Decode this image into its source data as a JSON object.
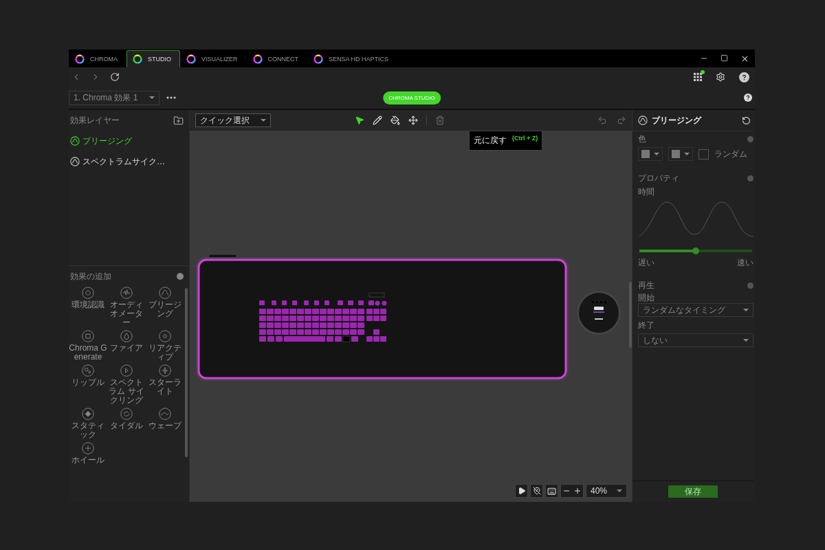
{
  "tabs": [
    {
      "label": "CHROMA",
      "selected": false
    },
    {
      "label": "STUDIO",
      "selected": true
    },
    {
      "label": "VISUALIZER",
      "selected": false
    },
    {
      "label": "CONNECT",
      "selected": false
    },
    {
      "label": "SENSA HD HAPTICS",
      "selected": false
    }
  ],
  "apps": {
    "notification": true
  },
  "effect_select": {
    "value": "1. Chroma 効果 1"
  },
  "mode_button": "CHROMA STUDIO",
  "layers": {
    "title": "効果レイヤー",
    "items": [
      {
        "label": "ブリージング",
        "selected": true
      },
      {
        "label": "スペクトラムサイク…",
        "selected": false
      }
    ]
  },
  "add_effects": {
    "title": "効果の追加",
    "items": [
      "環境認識",
      "オーディオメーター",
      "ブリージング",
      "Chroma Generate",
      "ファイア",
      "リアクティブ",
      "リップル",
      "スペクトラム サイクリング",
      "スターライト",
      "スタティック",
      "タイダル",
      "ウェーブ",
      "ホイール"
    ]
  },
  "toolbar": {
    "selection_mode": "クイック選択",
    "tools": [
      {
        "kind": "select",
        "selected": true
      },
      {
        "kind": "pencil",
        "selected": false
      },
      {
        "kind": "fill",
        "selected": false
      },
      {
        "kind": "move",
        "selected": false
      },
      {
        "kind": "delete",
        "selected": false
      }
    ]
  },
  "tooltip": {
    "label": "元に戻す",
    "shortcut": "(Ctrl + Z)"
  },
  "zoom": {
    "value": "40%"
  },
  "properties": {
    "title": "ブリージング",
    "color_label": "色",
    "random": {
      "label": "ランダム",
      "checked": false
    },
    "section": "プロパティ",
    "duration_label": "時間",
    "speed": {
      "level": 0.5,
      "min_label": "遅い",
      "max_label": "速い"
    },
    "playback": "再生",
    "start_label": "開始",
    "start_value": "ランダムなタイミング",
    "end_label": "終了",
    "end_value": "しない"
  },
  "save_button": {
    "label": "保存",
    "disabled": true
  }
}
